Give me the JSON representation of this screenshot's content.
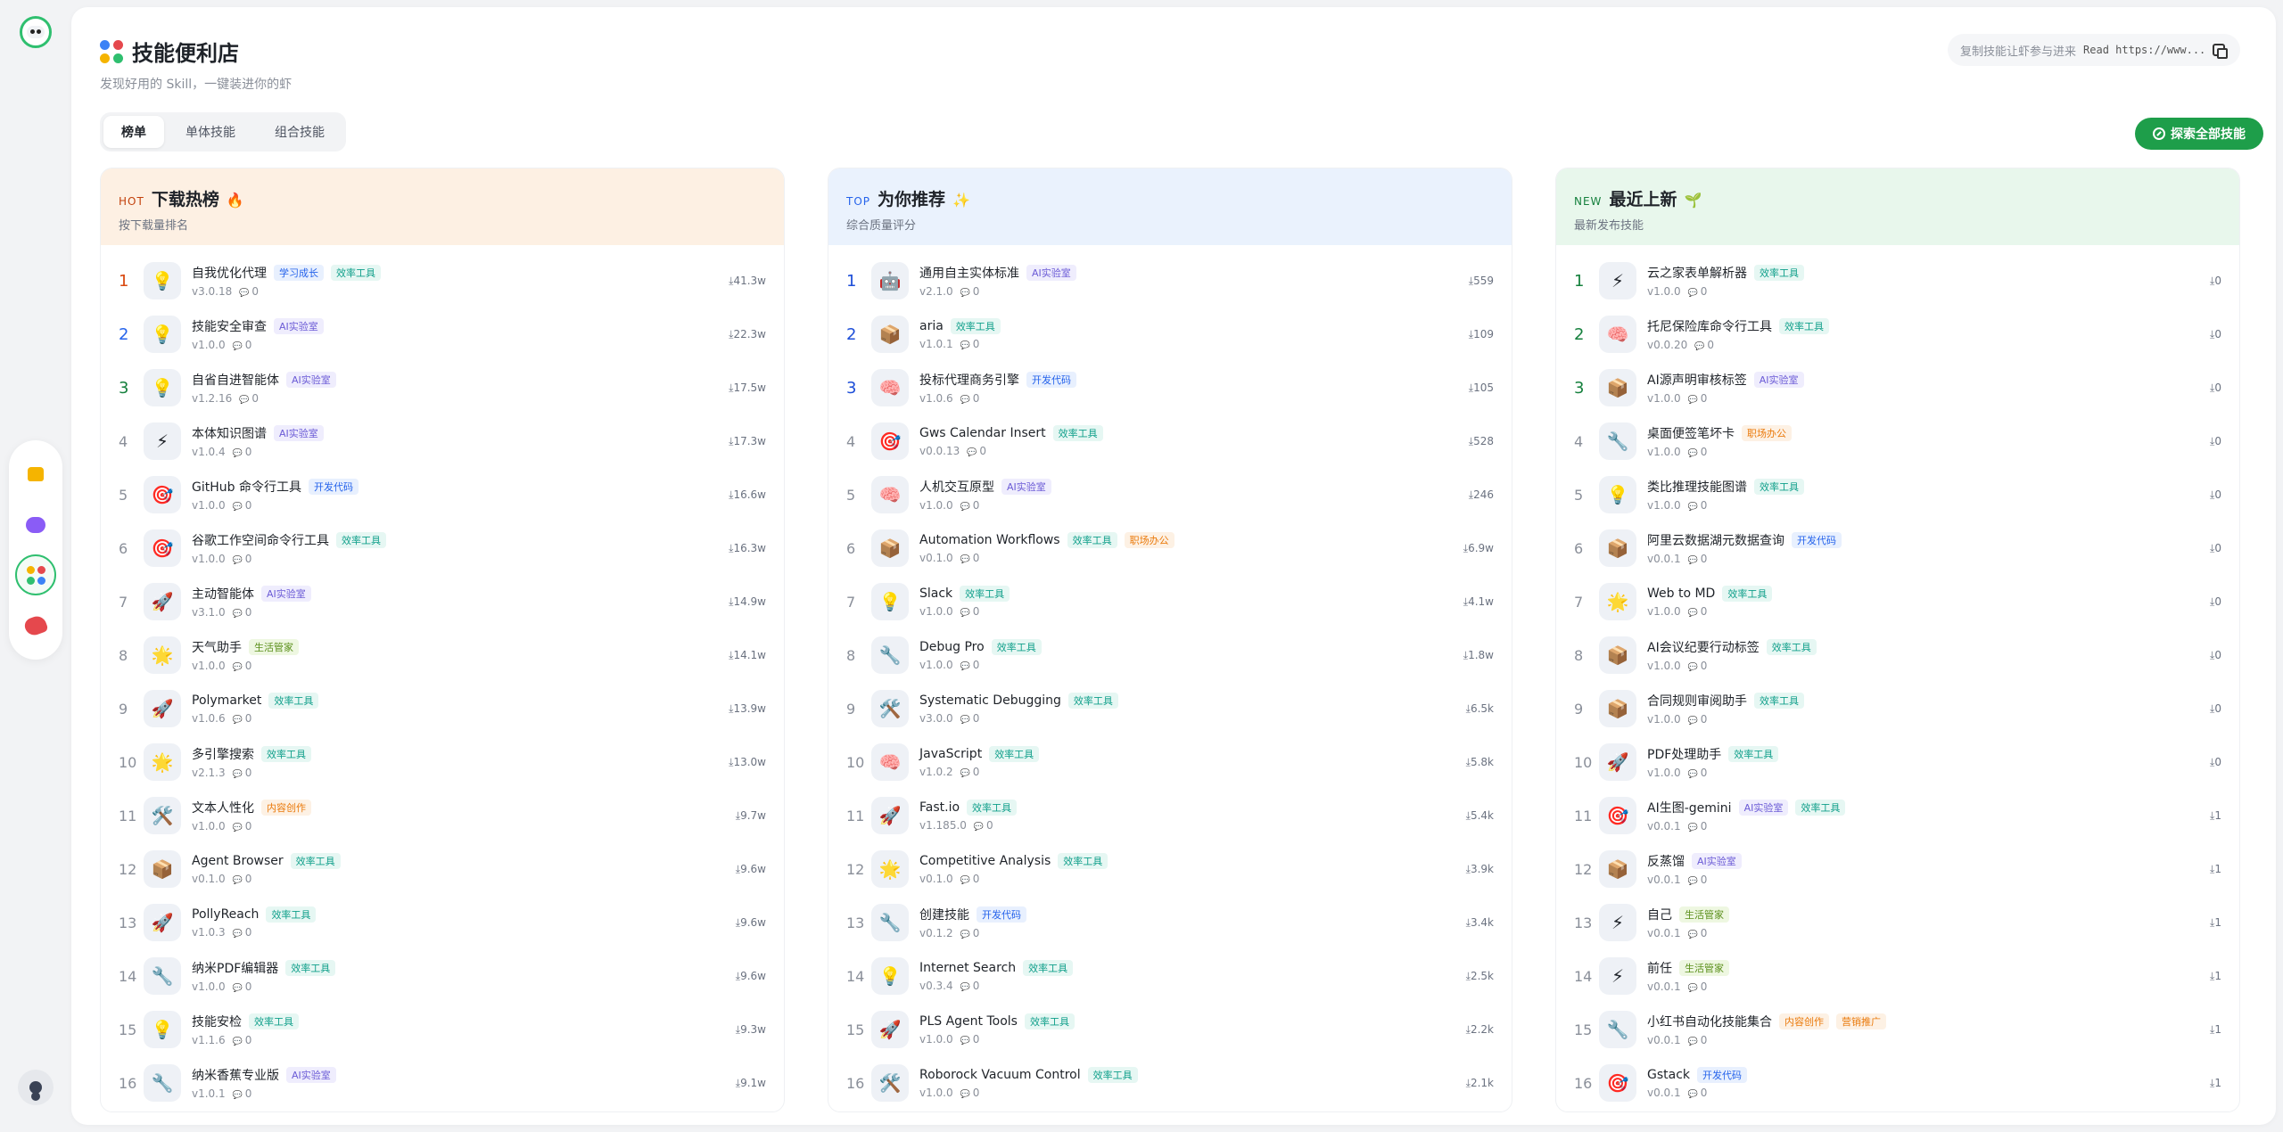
{
  "header": {
    "title": "技能便利店",
    "subtitle": "发现好用的 Skill，一键装进你的虾",
    "copy_label": "复制技能让虾参与进来",
    "copy_text": "Read https://www..."
  },
  "tabs": [
    "榜单",
    "单体技能",
    "组合技能"
  ],
  "explore_label": "探索全部技能",
  "colors": {
    "accent_green": "#1e9e4a",
    "tag_blue": "#2563eb",
    "tag_teal": "#0f9f8a",
    "tag_purple": "#6b5bd6",
    "tag_orange": "#ea7a0c",
    "tag_lime": "#5a8f1a"
  },
  "columns": [
    {
      "tag": "HOT",
      "title": "下载热榜",
      "emoji": "🔥",
      "subtitle": "按下载量排名",
      "items": [
        {
          "rank": "1",
          "icon": "💡",
          "name": "自我优化代理",
          "tags": [
            {
              "t": "学习成长",
              "c": "blue"
            },
            {
              "t": "效率工具",
              "c": "teal"
            }
          ],
          "version": "v3.0.18",
          "comments": "0",
          "downloads": "41.3w"
        },
        {
          "rank": "2",
          "icon": "💡",
          "name": "技能安全审查",
          "tags": [
            {
              "t": "AI实验室",
              "c": "purple"
            }
          ],
          "version": "v1.0.0",
          "comments": "0",
          "downloads": "22.3w"
        },
        {
          "rank": "3",
          "icon": "💡",
          "name": "自省自进智能体",
          "tags": [
            {
              "t": "AI实验室",
              "c": "purple"
            }
          ],
          "version": "v1.2.16",
          "comments": "0",
          "downloads": "17.5w"
        },
        {
          "rank": "4",
          "icon": "⚡",
          "name": "本体知识图谱",
          "tags": [
            {
              "t": "AI实验室",
              "c": "purple"
            }
          ],
          "version": "v1.0.4",
          "comments": "0",
          "downloads": "17.3w"
        },
        {
          "rank": "5",
          "icon": "🎯",
          "name": "GitHub 命令行工具",
          "tags": [
            {
              "t": "开发代码",
              "c": "blue"
            }
          ],
          "version": "v1.0.0",
          "comments": "0",
          "downloads": "16.6w"
        },
        {
          "rank": "6",
          "icon": "🎯",
          "name": "谷歌工作空间命令行工具",
          "tags": [
            {
              "t": "效率工具",
              "c": "teal"
            }
          ],
          "version": "v1.0.0",
          "comments": "0",
          "downloads": "16.3w"
        },
        {
          "rank": "7",
          "icon": "🚀",
          "name": "主动智能体",
          "tags": [
            {
              "t": "AI实验室",
              "c": "purple"
            }
          ],
          "version": "v3.1.0",
          "comments": "0",
          "downloads": "14.9w"
        },
        {
          "rank": "8",
          "icon": "🌟",
          "name": "天气助手",
          "tags": [
            {
              "t": "生活管家",
              "c": "lime"
            }
          ],
          "version": "v1.0.0",
          "comments": "0",
          "downloads": "14.1w"
        },
        {
          "rank": "9",
          "icon": "🚀",
          "name": "Polymarket",
          "tags": [
            {
              "t": "效率工具",
              "c": "teal"
            }
          ],
          "version": "v1.0.6",
          "comments": "0",
          "downloads": "13.9w"
        },
        {
          "rank": "10",
          "icon": "🌟",
          "name": "多引擎搜索",
          "tags": [
            {
              "t": "效率工具",
              "c": "teal"
            }
          ],
          "version": "v2.1.3",
          "comments": "0",
          "downloads": "13.0w"
        },
        {
          "rank": "11",
          "icon": "🛠️",
          "name": "文本人性化",
          "tags": [
            {
              "t": "内容创作",
              "c": "orange"
            }
          ],
          "version": "v1.0.0",
          "comments": "0",
          "downloads": "9.7w"
        },
        {
          "rank": "12",
          "icon": "📦",
          "name": "Agent Browser",
          "tags": [
            {
              "t": "效率工具",
              "c": "teal"
            }
          ],
          "version": "v0.1.0",
          "comments": "0",
          "downloads": "9.6w"
        },
        {
          "rank": "13",
          "icon": "🚀",
          "name": "PollyReach",
          "tags": [
            {
              "t": "效率工具",
              "c": "teal"
            }
          ],
          "version": "v1.0.3",
          "comments": "0",
          "downloads": "9.6w"
        },
        {
          "rank": "14",
          "icon": "🔧",
          "name": "纳米PDF编辑器",
          "tags": [
            {
              "t": "效率工具",
              "c": "teal"
            }
          ],
          "version": "v1.0.0",
          "comments": "0",
          "downloads": "9.6w"
        },
        {
          "rank": "15",
          "icon": "💡",
          "name": "技能安检",
          "tags": [
            {
              "t": "效率工具",
              "c": "teal"
            }
          ],
          "version": "v1.1.6",
          "comments": "0",
          "downloads": "9.3w"
        },
        {
          "rank": "16",
          "icon": "🔧",
          "name": "纳米香蕉专业版",
          "tags": [
            {
              "t": "AI实验室",
              "c": "purple"
            }
          ],
          "version": "v1.0.1",
          "comments": "0",
          "downloads": "9.1w"
        }
      ]
    },
    {
      "tag": "TOP",
      "title": "为你推荐",
      "emoji": "✨",
      "subtitle": "综合质量评分",
      "items": [
        {
          "rank": "1",
          "icon": "🤖",
          "name": "通用自主实体标准",
          "tags": [
            {
              "t": "AI实验室",
              "c": "purple"
            }
          ],
          "version": "v2.1.0",
          "comments": "0",
          "downloads": "559"
        },
        {
          "rank": "2",
          "icon": "📦",
          "name": "aria",
          "tags": [
            {
              "t": "效率工具",
              "c": "teal"
            }
          ],
          "version": "v1.0.1",
          "comments": "0",
          "downloads": "109"
        },
        {
          "rank": "3",
          "icon": "🧠",
          "name": "投标代理商务引擎",
          "tags": [
            {
              "t": "开发代码",
              "c": "blue"
            }
          ],
          "version": "v1.0.6",
          "comments": "0",
          "downloads": "105"
        },
        {
          "rank": "4",
          "icon": "🎯",
          "name": "Gws Calendar Insert",
          "tags": [
            {
              "t": "效率工具",
              "c": "teal"
            }
          ],
          "version": "v0.0.13",
          "comments": "0",
          "downloads": "528"
        },
        {
          "rank": "5",
          "icon": "🧠",
          "name": "人机交互原型",
          "tags": [
            {
              "t": "AI实验室",
              "c": "purple"
            }
          ],
          "version": "v1.0.0",
          "comments": "0",
          "downloads": "246"
        },
        {
          "rank": "6",
          "icon": "📦",
          "name": "Automation Workflows",
          "tags": [
            {
              "t": "效率工具",
              "c": "teal"
            },
            {
              "t": "职场办公",
              "c": "orange"
            }
          ],
          "version": "v0.1.0",
          "comments": "0",
          "downloads": "6.9w"
        },
        {
          "rank": "7",
          "icon": "💡",
          "name": "Slack",
          "tags": [
            {
              "t": "效率工具",
              "c": "teal"
            }
          ],
          "version": "v1.0.0",
          "comments": "0",
          "downloads": "4.1w"
        },
        {
          "rank": "8",
          "icon": "🔧",
          "name": "Debug Pro",
          "tags": [
            {
              "t": "效率工具",
              "c": "teal"
            }
          ],
          "version": "v1.0.0",
          "comments": "0",
          "downloads": "1.8w"
        },
        {
          "rank": "9",
          "icon": "🛠️",
          "name": "Systematic Debugging",
          "tags": [
            {
              "t": "效率工具",
              "c": "teal"
            }
          ],
          "version": "v3.0.0",
          "comments": "0",
          "downloads": "6.5k"
        },
        {
          "rank": "10",
          "icon": "🧠",
          "name": "JavaScript",
          "tags": [
            {
              "t": "效率工具",
              "c": "teal"
            }
          ],
          "version": "v1.0.2",
          "comments": "0",
          "downloads": "5.8k"
        },
        {
          "rank": "11",
          "icon": "🚀",
          "name": "Fast.io",
          "tags": [
            {
              "t": "效率工具",
              "c": "teal"
            }
          ],
          "version": "v1.185.0",
          "comments": "0",
          "downloads": "5.4k"
        },
        {
          "rank": "12",
          "icon": "🌟",
          "name": "Competitive Analysis",
          "tags": [
            {
              "t": "效率工具",
              "c": "teal"
            }
          ],
          "version": "v0.1.0",
          "comments": "0",
          "downloads": "3.9k"
        },
        {
          "rank": "13",
          "icon": "🔧",
          "name": "创建技能",
          "tags": [
            {
              "t": "开发代码",
              "c": "blue"
            }
          ],
          "version": "v0.1.2",
          "comments": "0",
          "downloads": "3.4k"
        },
        {
          "rank": "14",
          "icon": "💡",
          "name": "Internet Search",
          "tags": [
            {
              "t": "效率工具",
              "c": "teal"
            }
          ],
          "version": "v0.3.4",
          "comments": "0",
          "downloads": "2.5k"
        },
        {
          "rank": "15",
          "icon": "🚀",
          "name": "PLS Agent Tools",
          "tags": [
            {
              "t": "效率工具",
              "c": "teal"
            }
          ],
          "version": "v1.0.0",
          "comments": "0",
          "downloads": "2.2k"
        },
        {
          "rank": "16",
          "icon": "🛠️",
          "name": "Roborock Vacuum Control",
          "tags": [
            {
              "t": "效率工具",
              "c": "teal"
            }
          ],
          "version": "v1.0.0",
          "comments": "0",
          "downloads": "2.1k"
        }
      ]
    },
    {
      "tag": "NEW",
      "title": "最近上新",
      "emoji": "🌱",
      "subtitle": "最新发布技能",
      "items": [
        {
          "rank": "1",
          "icon": "⚡",
          "name": "云之家表单解析器",
          "tags": [
            {
              "t": "效率工具",
              "c": "teal"
            }
          ],
          "version": "v1.0.0",
          "comments": "0",
          "downloads": "0"
        },
        {
          "rank": "2",
          "icon": "🧠",
          "name": "托尼保险库命令行工具",
          "tags": [
            {
              "t": "效率工具",
              "c": "teal"
            }
          ],
          "version": "v0.0.20",
          "comments": "0",
          "downloads": "0"
        },
        {
          "rank": "3",
          "icon": "📦",
          "name": "AI源声明审核标签",
          "tags": [
            {
              "t": "AI实验室",
              "c": "purple"
            }
          ],
          "version": "v1.0.0",
          "comments": "0",
          "downloads": "0"
        },
        {
          "rank": "4",
          "icon": "🔧",
          "name": "桌面便签笔坏卡",
          "tags": [
            {
              "t": "职场办公",
              "c": "orange"
            }
          ],
          "version": "v1.0.0",
          "comments": "0",
          "downloads": "0"
        },
        {
          "rank": "5",
          "icon": "💡",
          "name": "类比推理技能图谱",
          "tags": [
            {
              "t": "效率工具",
              "c": "teal"
            }
          ],
          "version": "v1.0.0",
          "comments": "0",
          "downloads": "0"
        },
        {
          "rank": "6",
          "icon": "📦",
          "name": "阿里云数据湖元数据查询",
          "tags": [
            {
              "t": "开发代码",
              "c": "blue"
            }
          ],
          "version": "v0.0.1",
          "comments": "0",
          "downloads": "0"
        },
        {
          "rank": "7",
          "icon": "🌟",
          "name": "Web to MD",
          "tags": [
            {
              "t": "效率工具",
              "c": "teal"
            }
          ],
          "version": "v1.0.0",
          "comments": "0",
          "downloads": "0"
        },
        {
          "rank": "8",
          "icon": "📦",
          "name": "AI会议纪要行动标签",
          "tags": [
            {
              "t": "效率工具",
              "c": "teal"
            }
          ],
          "version": "v1.0.0",
          "comments": "0",
          "downloads": "0"
        },
        {
          "rank": "9",
          "icon": "📦",
          "name": "合同规则审阅助手",
          "tags": [
            {
              "t": "效率工具",
              "c": "teal"
            }
          ],
          "version": "v1.0.0",
          "comments": "0",
          "downloads": "0"
        },
        {
          "rank": "10",
          "icon": "🚀",
          "name": "PDF处理助手",
          "tags": [
            {
              "t": "效率工具",
              "c": "teal"
            }
          ],
          "version": "v1.0.0",
          "comments": "0",
          "downloads": "0"
        },
        {
          "rank": "11",
          "icon": "🎯",
          "name": "AI生图-gemini",
          "tags": [
            {
              "t": "AI实验室",
              "c": "purple"
            },
            {
              "t": "效率工具",
              "c": "teal"
            }
          ],
          "version": "v0.0.1",
          "comments": "0",
          "downloads": "1"
        },
        {
          "rank": "12",
          "icon": "📦",
          "name": "反蒸馏",
          "tags": [
            {
              "t": "AI实验室",
              "c": "purple"
            }
          ],
          "version": "v0.0.1",
          "comments": "0",
          "downloads": "1"
        },
        {
          "rank": "13",
          "icon": "⚡",
          "name": "自己",
          "tags": [
            {
              "t": "生活管家",
              "c": "lime"
            }
          ],
          "version": "v0.0.1",
          "comments": "0",
          "downloads": "1"
        },
        {
          "rank": "14",
          "icon": "⚡",
          "name": "前任",
          "tags": [
            {
              "t": "生活管家",
              "c": "lime"
            }
          ],
          "version": "v0.0.1",
          "comments": "0",
          "downloads": "1"
        },
        {
          "rank": "15",
          "icon": "🔧",
          "name": "小红书自动化技能集合",
          "tags": [
            {
              "t": "内容创作",
              "c": "orange"
            },
            {
              "t": "营销推广",
              "c": "orange"
            }
          ],
          "version": "v0.0.1",
          "comments": "0",
          "downloads": "1"
        },
        {
          "rank": "16",
          "icon": "🎯",
          "name": "Gstack",
          "tags": [
            {
              "t": "开发代码",
              "c": "blue"
            }
          ],
          "version": "v0.0.1",
          "comments": "0",
          "downloads": "1"
        }
      ]
    }
  ]
}
